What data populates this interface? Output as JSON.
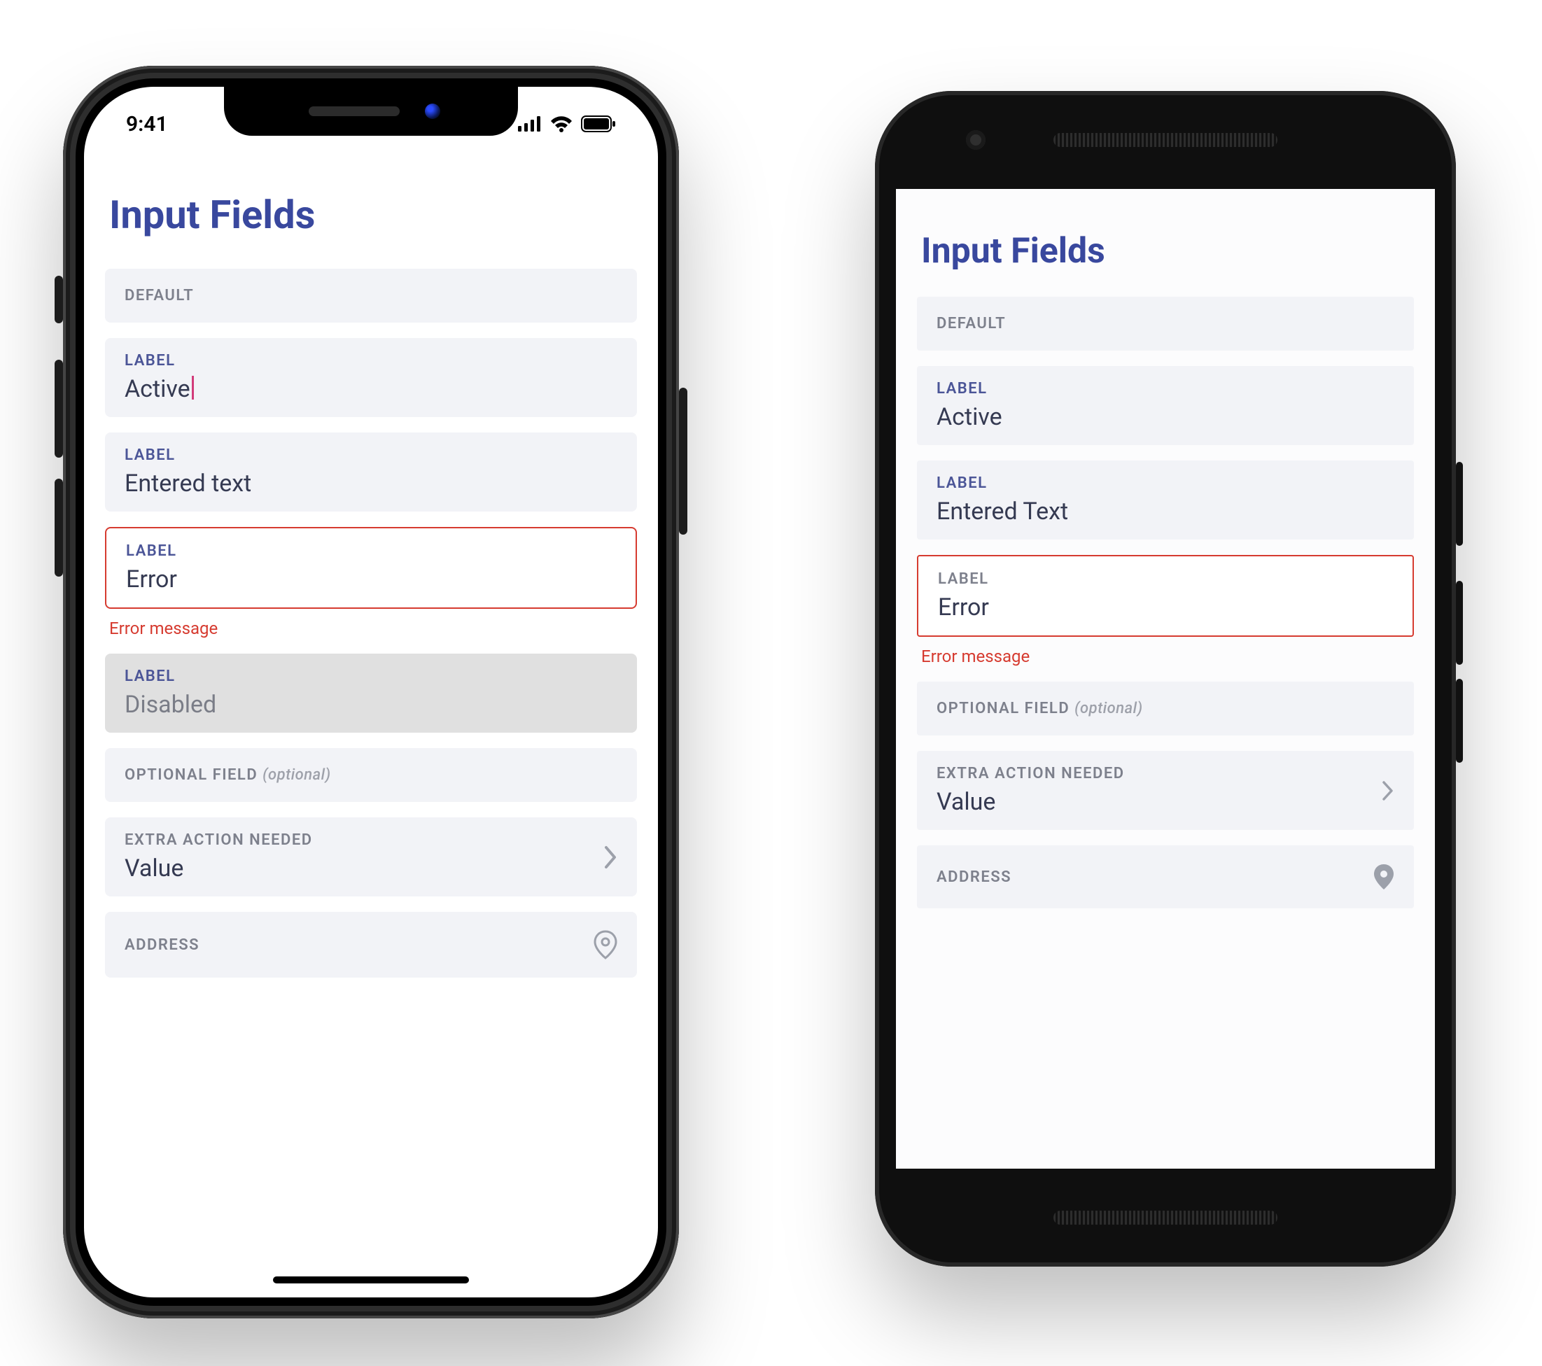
{
  "status": {
    "time": "9:41"
  },
  "ios": {
    "title": "Input Fields",
    "fields": {
      "default": {
        "label": "DEFAULT"
      },
      "active": {
        "label": "LABEL",
        "value": "Active"
      },
      "entered": {
        "label": "LABEL",
        "value": "Entered text"
      },
      "error": {
        "label": "LABEL",
        "value": "Error",
        "message": "Error message"
      },
      "disabled": {
        "label": "LABEL",
        "value": "Disabled"
      },
      "optional": {
        "label": "OPTIONAL FIELD",
        "tag": "(optional)"
      },
      "extra": {
        "label": "EXTRA ACTION NEEDED",
        "value": "Value"
      },
      "address": {
        "label": "ADDRESS"
      }
    }
  },
  "android": {
    "title": "Input Fields",
    "fields": {
      "default": {
        "label": "DEFAULT"
      },
      "active": {
        "label": "LABEL",
        "value": "Active"
      },
      "entered": {
        "label": "LABEL",
        "value": "Entered Text"
      },
      "error": {
        "label": "LABEL",
        "value": "Error",
        "message": "Error message"
      },
      "optional": {
        "label": "OPTIONAL FIELD",
        "tag": "(optional)"
      },
      "extra": {
        "label": "EXTRA ACTION NEEDED",
        "value": "Value"
      },
      "address": {
        "label": "ADDRESS"
      }
    }
  },
  "colors": {
    "accent": "#39489e",
    "label": "#4b5597",
    "muted": "#7d808c",
    "error": "#d63b30",
    "field_bg": "#f2f3f7",
    "disabled_bg": "#e0e0e0",
    "cursor": "#d23b7a"
  }
}
